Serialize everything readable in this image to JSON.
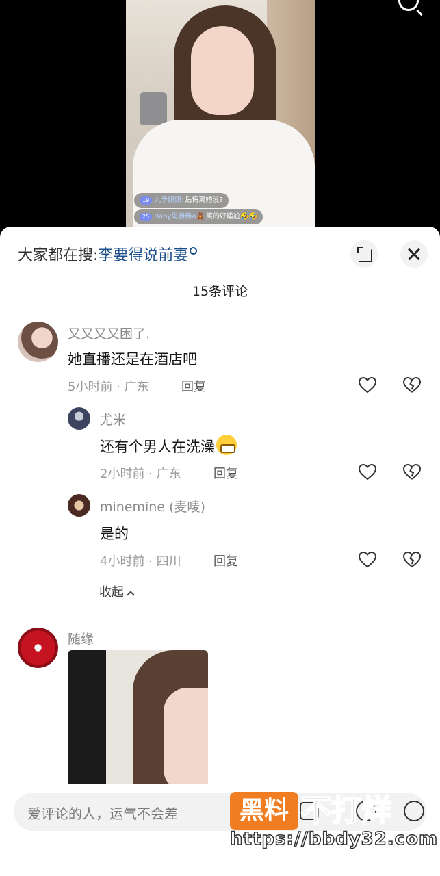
{
  "live": {
    "danmu": [
      {
        "level": "19",
        "name": "九予妍妍:",
        "text": "后悔离婚没?"
      },
      {
        "level": "25",
        "name": "Baby是雅雅a🧸",
        "text": "笑的好尴尬🤣🤣"
      }
    ]
  },
  "hot_search": {
    "prefix": "大家都在搜:",
    "keyword": "李要得说前妻"
  },
  "comment_count": "15条评论",
  "comments": [
    {
      "user": "又又又又困了.",
      "text": "她直播还是在酒店吧",
      "meta": "5小时前 · 广东",
      "reply": "回复"
    },
    {
      "user": "尤米",
      "text": "还有个男人在洗澡",
      "meta": "2小时前 · 广东",
      "reply": "回复"
    },
    {
      "user": "minemine (麦唛)",
      "text": "是的",
      "meta": "4小时前 · 四川",
      "reply": "回复"
    },
    {
      "user": "随缘"
    }
  ],
  "collapse_label": "收起",
  "input": {
    "placeholder": "爱评论的人，运气不会差"
  },
  "watermark": {
    "badge": "黑料",
    "text": "不打烊",
    "url": "https://bbdy32.com"
  },
  "icons": [
    "search-icon",
    "expand-icon",
    "close-icon",
    "heart-icon",
    "dislike-icon",
    "image-icon",
    "at-icon",
    "emoji-icon"
  ]
}
